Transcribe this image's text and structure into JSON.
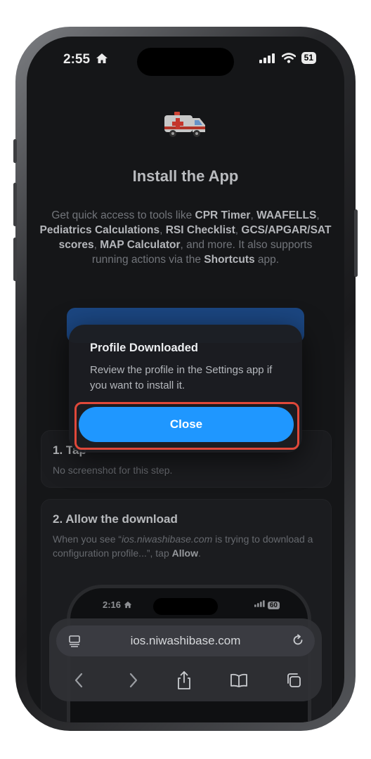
{
  "status_bar": {
    "time": "2:55",
    "battery": "51"
  },
  "page": {
    "title": "Install the App",
    "description_parts": {
      "p1": "Get quick access to tools like ",
      "b1": "CPR Timer",
      "p2": ", ",
      "b2": "WAAFELLS",
      "p3": ", ",
      "b3": "Pediatrics Calculations",
      "p4": ", ",
      "b4": "RSI Checklist",
      "p5": ", ",
      "b5": "GCS/APGAR/SAT scores",
      "p6": ", ",
      "b6": "MAP Calculator",
      "p7": ", and more. It also supports running actions via the ",
      "b7": "Shortcuts",
      "p8": " app."
    },
    "step1": {
      "title": "1. Tap",
      "text": "No screenshot for this step."
    },
    "step2": {
      "title": "2. Allow the download",
      "text_parts": {
        "p1": "When you see “",
        "i1": "ios.niwashibase.com",
        "p2": " is trying to download a configuration profile...”, tap ",
        "b1": "Allow",
        "p3": "."
      }
    },
    "mini_phone": {
      "time": "2:16",
      "battery": "60"
    }
  },
  "alert": {
    "title": "Profile Downloaded",
    "message": "Review the profile in the Settings app if you want to install it.",
    "close_label": "Close"
  },
  "safari": {
    "url": "ios.niwashibase.com"
  },
  "colors": {
    "accent": "#1f97ff",
    "highlight": "#e0483a"
  }
}
